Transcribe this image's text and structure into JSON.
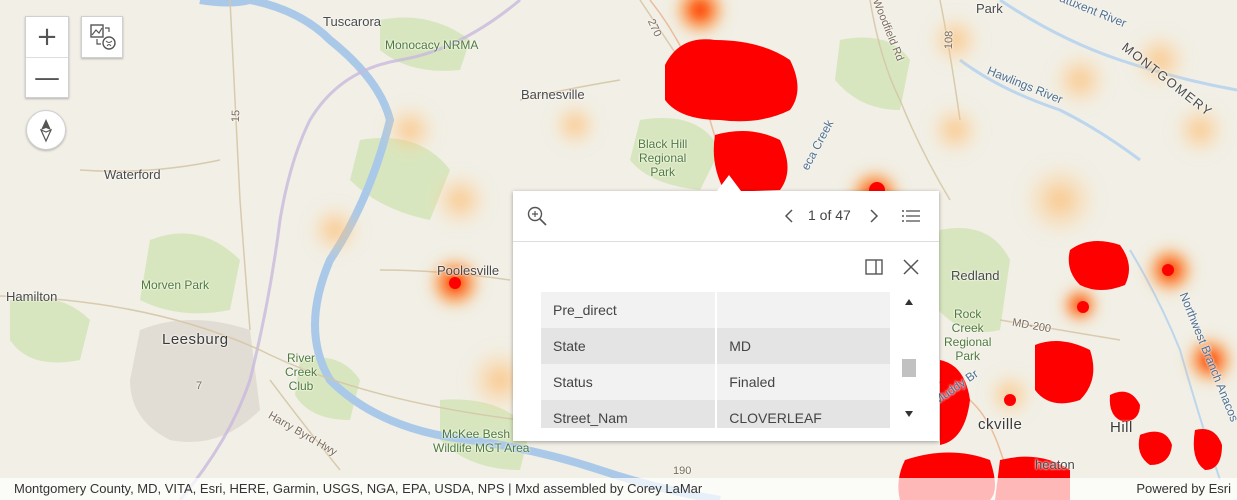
{
  "map": {
    "places": {
      "tuscarora": "Tuscarora",
      "monocacy": "Monocacy NRMA",
      "barnesville": "Barnesville",
      "black_hill": "Black Hill\nRegional\nPark",
      "waterford": "Waterford",
      "poolesville": "Poolesville",
      "hamilton": "Hamilton",
      "morven_park": "Morven Park",
      "leesburg": "Leesburg",
      "river_creek": "River\nCreek\nClub",
      "mckee_beshers": "McKee Besh",
      "wildlife_mgt": "Wildlife MGT Area",
      "redland": "Redland",
      "rock_creek": "Rock\nCreek\nRegional\nPark",
      "rockville": "ckville",
      "hill": "Hill",
      "wheaton": "heaton",
      "park": "Park",
      "montgomery": "MONTGOMERY",
      "patuxent": "Patuxent River",
      "hawlings": "Hawlings River",
      "woodfield": "Woodfield Rd",
      "seneca": "eca Creek",
      "nw_branch": "Northwest Branch Anacos",
      "harry_byrd": "Harry Byrd Hwy",
      "muddy_branch": "Muddy Br",
      "rt270": "270",
      "rt15": "15",
      "rt108": "108",
      "rt190": "190",
      "rt7": "7",
      "md200": "MD-200"
    }
  },
  "controls": {
    "zoom_in": "+",
    "zoom_out": "—",
    "basemap_icon": "basemap-toggle-icon",
    "compass_icon": "compass-icon"
  },
  "popup": {
    "pager": "1 of 47",
    "rows": [
      {
        "key": "Pre_direct",
        "value": ""
      },
      {
        "key": "State",
        "value": "MD"
      },
      {
        "key": "Status",
        "value": "Finaled"
      },
      {
        "key": "Street_Nam",
        "value": "CLOVERLEAF"
      }
    ]
  },
  "attribution": {
    "credits": "Montgomery County, MD, VITA, Esri, HERE, Garmin, USGS, NGA, EPA, USDA, NPS | Mxd assembled by Corey LaMar",
    "powered": "Powered by Esri"
  }
}
